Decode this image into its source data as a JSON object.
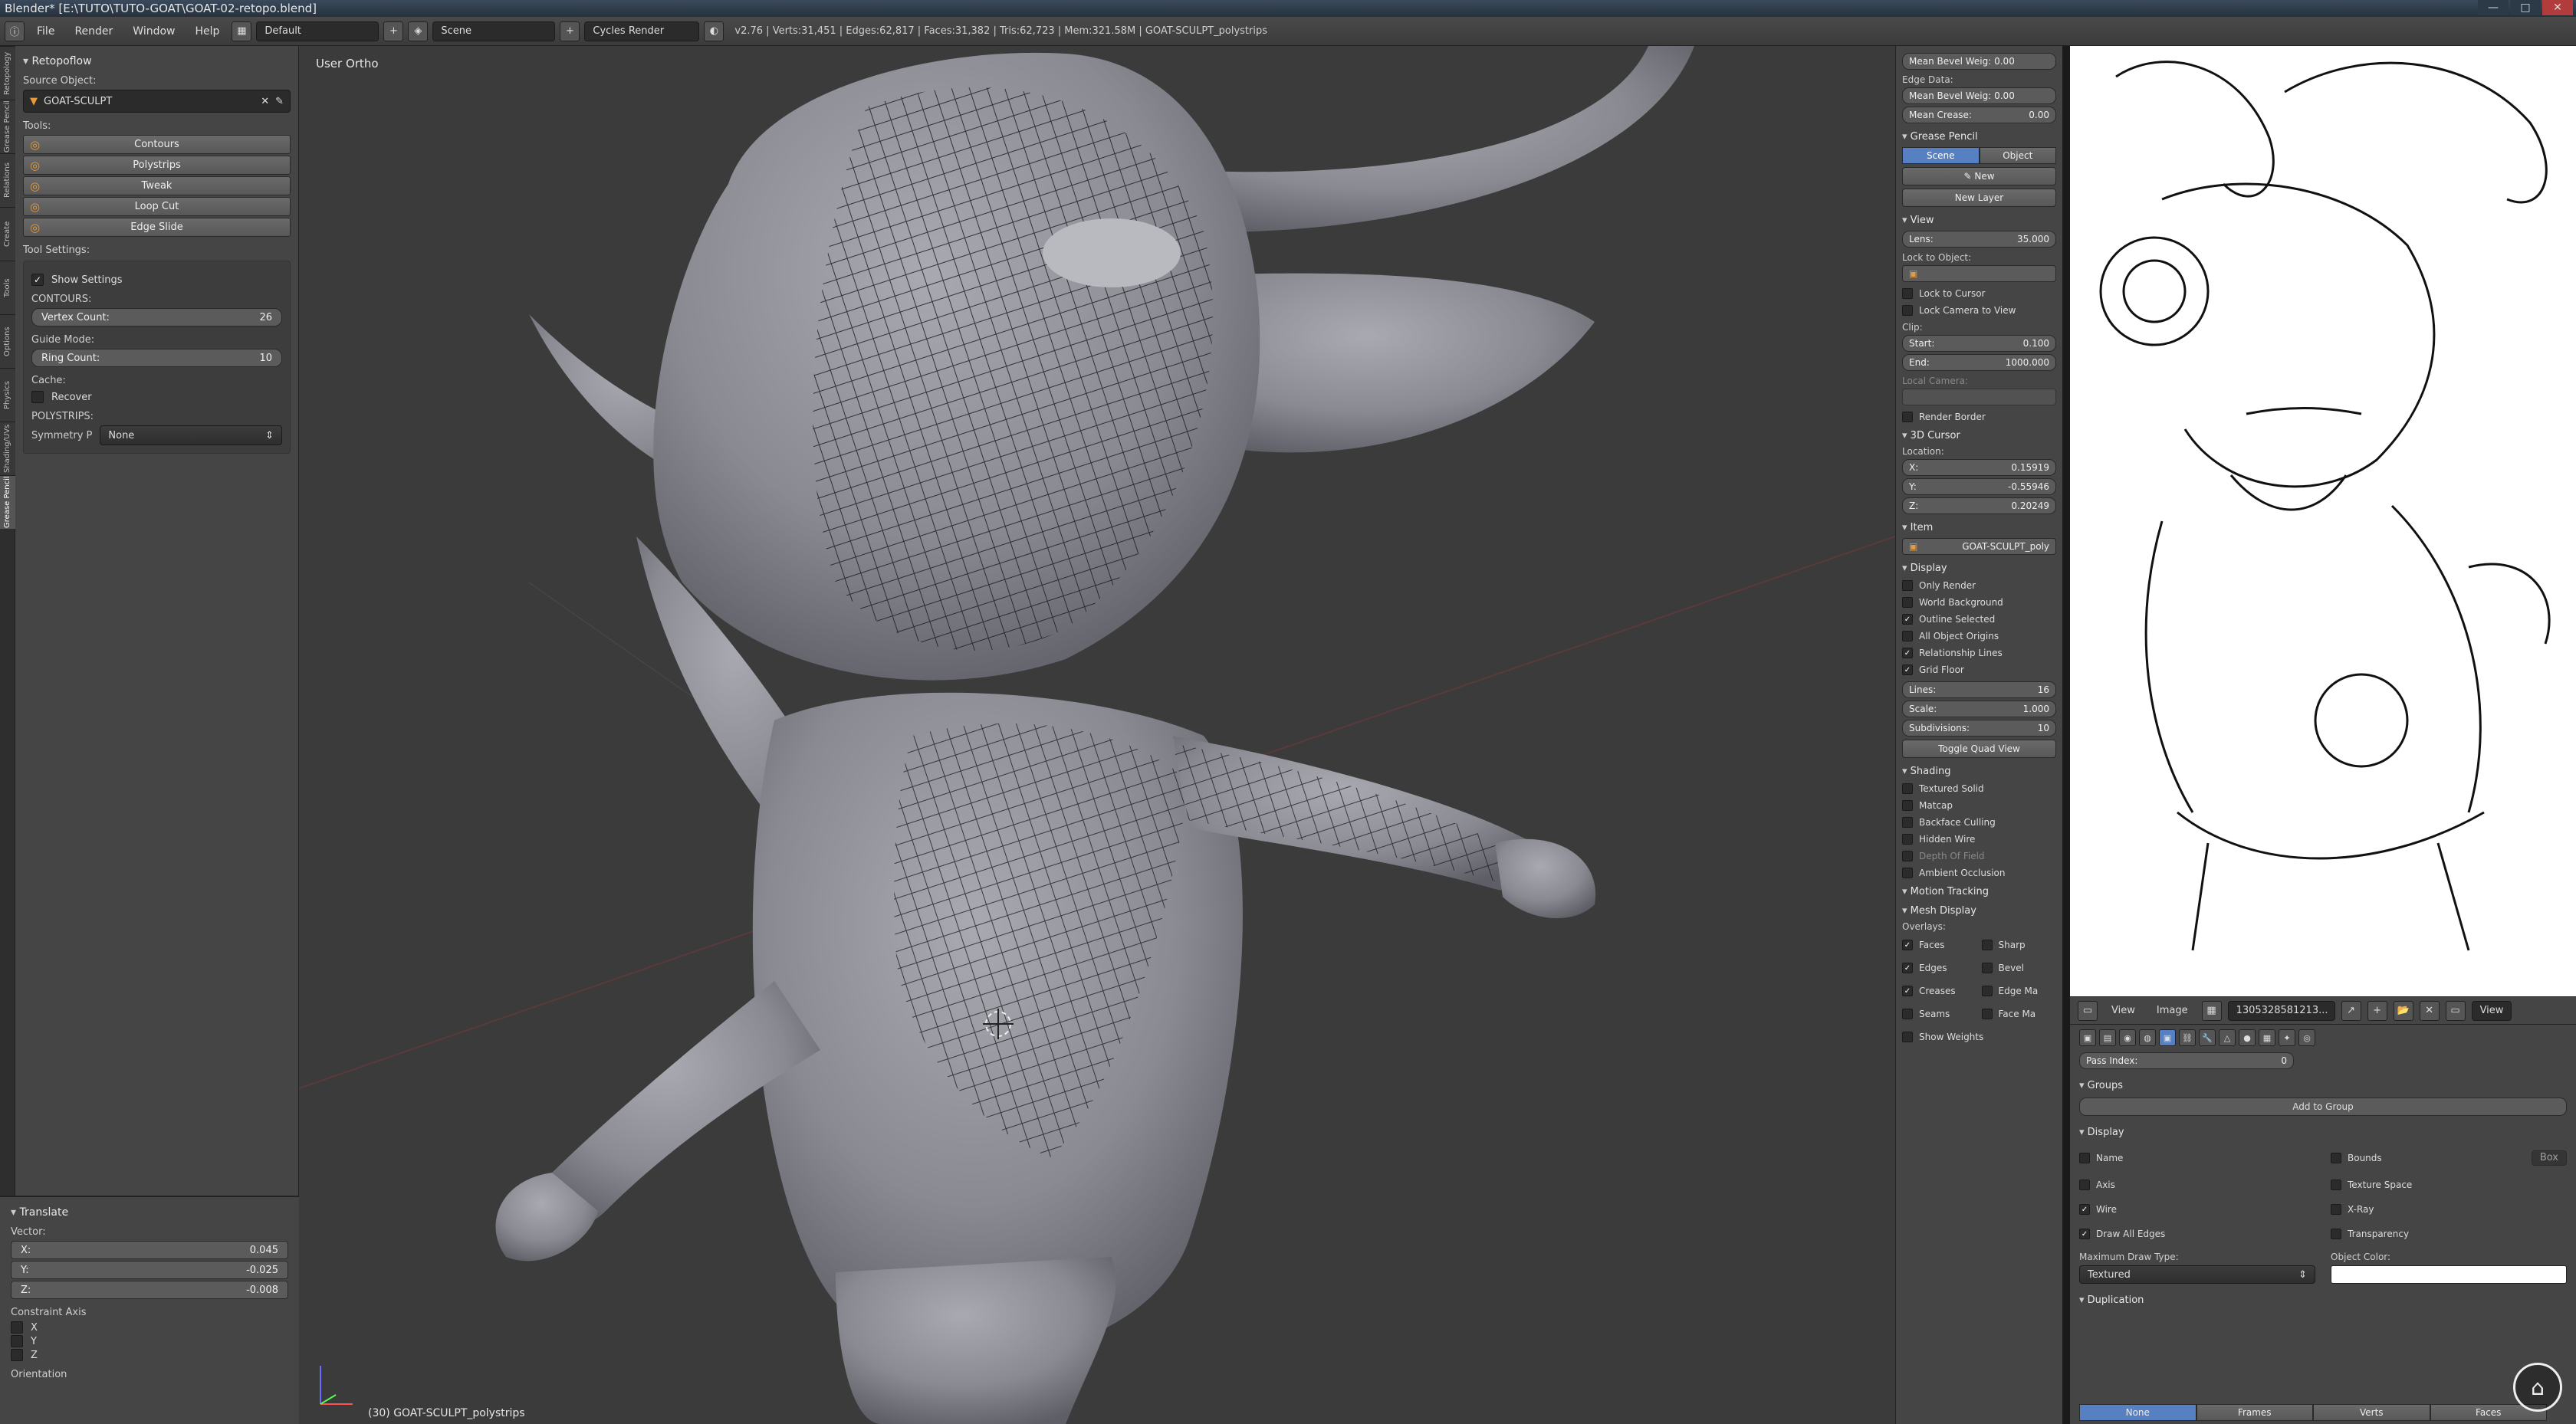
{
  "window": {
    "title": "Blender* [E:\\TUTO\\TUTO-GOAT\\GOAT-02-retopo.blend]",
    "controls": [
      "—",
      "□",
      "✕"
    ]
  },
  "infobar": {
    "menus": [
      "File",
      "Render",
      "Window",
      "Help"
    ],
    "layout": "Default",
    "scene": "Scene",
    "engine": "Cycles Render",
    "stats": "v2.76 | Verts:31,451 | Edges:62,817 | Faces:31,382 | Tris:62,723 | Mem:321.58M | GOAT-SCULPT_polystrips"
  },
  "left_tabs": [
    "Retopology",
    "Grease Pencil",
    "Relations",
    "Create",
    "Tools",
    "Options",
    "Physics",
    "Shading/UVs",
    "Grease Pencil"
  ],
  "toolshelf": {
    "panel_title": "Retopoflow",
    "source_label": "Source Object:",
    "source_object": "GOAT-SCULPT",
    "tools_label": "Tools:",
    "tools": [
      "Contours",
      "Polystrips",
      "Tweak",
      "Loop Cut",
      "Edge Slide"
    ],
    "tool_settings_label": "Tool Settings:",
    "show_settings": "Show Settings",
    "contours_label": "CONTOURS:",
    "vertex_count_label": "Vertex Count:",
    "vertex_count": "26",
    "guide_mode_label": "Guide Mode:",
    "ring_count_label": "Ring Count:",
    "ring_count": "10",
    "cache_label": "Cache:",
    "recover": "Recover",
    "polystrips_label": "POLYSTRIPS:",
    "symmetry_label": "Symmetry P",
    "symmetry_value": "None"
  },
  "operator": {
    "title": "Translate",
    "vector_label": "Vector:",
    "x_label": "X:",
    "x": "0.045",
    "y_label": "Y:",
    "y": "-0.025",
    "z_label": "Z:",
    "z": "-0.008",
    "constraint_label": "Constraint Axis",
    "axes": [
      "X",
      "Y",
      "Z"
    ],
    "orientation_label": "Orientation"
  },
  "viewport": {
    "view_label": "User Ortho",
    "object_label": "(30) GOAT-SCULPT_polystrips"
  },
  "props": {
    "mean_bevel": "Mean Bevel Weig: 0.00",
    "edge_data": "Edge Data:",
    "mean_bevel2": "Mean Bevel Weig: 0.00",
    "mean_crease": "Mean Crease:",
    "mean_crease_val": "0.00",
    "grease_pencil": "Grease Pencil",
    "gp_scene": "Scene",
    "gp_object": "Object",
    "gp_new": "New",
    "gp_new_layer": "New Layer",
    "view_title": "View",
    "lens_label": "Lens:",
    "lens": "35.000",
    "lock_object": "Lock to Object:",
    "lock_cursor": "Lock to Cursor",
    "lock_camera": "Lock Camera to View",
    "clip_label": "Clip:",
    "start_label": "Start:",
    "start": "0.100",
    "end_label": "End:",
    "end": "1000.000",
    "local_camera": "Local Camera:",
    "render_border": "Render Border",
    "cursor_title": "3D Cursor",
    "location_label": "Location:",
    "cx": "0.15919",
    "cy": "-0.55946",
    "cz": "0.20249",
    "item_title": "Item",
    "item_name": "GOAT-SCULPT_poly",
    "display_title": "Display",
    "only_render": "Only Render",
    "world_bg": "World Background",
    "outline_sel": "Outline Selected",
    "all_origins": "All Object Origins",
    "rel_lines": "Relationship Lines",
    "grid_floor": "Grid Floor",
    "lines_label": "Lines:",
    "lines": "16",
    "scale_label": "Scale:",
    "scale": "1.000",
    "subdiv_label": "Subdivisions:",
    "subdiv": "10",
    "toggle_quad": "Toggle Quad View",
    "shading_title": "Shading",
    "textured_solid": "Textured Solid",
    "matcap": "Matcap",
    "backface": "Backface Culling",
    "hidden_wire": "Hidden Wire",
    "depth_field": "Depth Of Field",
    "ambient_occ": "Ambient Occlusion",
    "motion_tracking": "Motion Tracking",
    "mesh_display": "Mesh Display",
    "overlays_label": "Overlays:",
    "faces": "Faces",
    "sharp": "Sharp",
    "edges": "Edges",
    "bevel": "Bevel",
    "creases": "Creases",
    "edge_marks": "Edge Ma",
    "seams": "Seams",
    "face_marks": "Face Ma",
    "show_weights": "Show Weights"
  },
  "image_editor": {
    "menus": [
      "View",
      "Image"
    ],
    "image_name": "1305328581213...",
    "view_mode": "View"
  },
  "obj_props": {
    "pass_index_label": "Pass Index:",
    "pass_index": "0",
    "groups_title": "Groups",
    "add_to_group": "Add to Group",
    "display_title": "Display",
    "name": "Name",
    "bounds": "Bounds",
    "box": "Box",
    "axis": "Axis",
    "texture_space": "Texture Space",
    "wire": "Wire",
    "xray": "X-Ray",
    "draw_all_edges": "Draw All Edges",
    "transparency": "Transparency",
    "max_draw_label": "Maximum Draw Type:",
    "max_draw": "Textured",
    "obj_color_label": "Object Color:",
    "dup_title": "Duplication",
    "dup_modes": [
      "None",
      "Frames",
      "Verts",
      "Faces"
    ]
  },
  "colors": {
    "accent": "#5680c2",
    "tool_icon": "#e89b3c",
    "viewport_bg": "#3b3b3b",
    "mesh_gray": "#8c8c94"
  }
}
